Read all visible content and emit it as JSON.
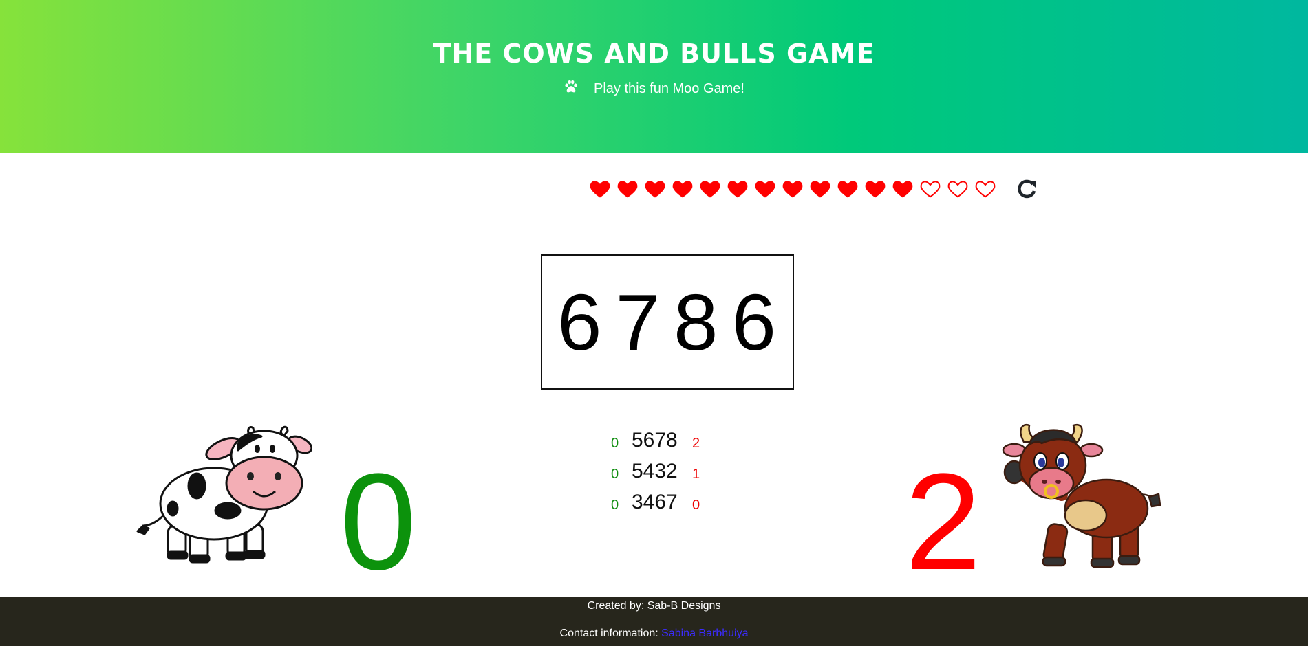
{
  "header": {
    "title": "THE COWS AND BULLS GAME",
    "subtitle": "Play this fun Moo Game!",
    "subtitle_icon": "paw-icon"
  },
  "lives": {
    "total": 15,
    "filled": 12,
    "color": "#ff0000",
    "reset_icon": "refresh-icon"
  },
  "current_guess": "6786",
  "history": [
    {
      "cows": "0",
      "guess": "5678",
      "bulls": "2"
    },
    {
      "cows": "0",
      "guess": "5432",
      "bulls": "1"
    },
    {
      "cows": "0",
      "guess": "3467",
      "bulls": "0"
    }
  ],
  "score": {
    "cows": "0",
    "bulls": "2",
    "cows_color": "#0c920c",
    "bulls_color": "#ff0000"
  },
  "footer": {
    "created_by": "Created by: Sab-B Designs",
    "contact_label": "Contact information:",
    "contact_name": "Sabina Barbhuiya"
  }
}
